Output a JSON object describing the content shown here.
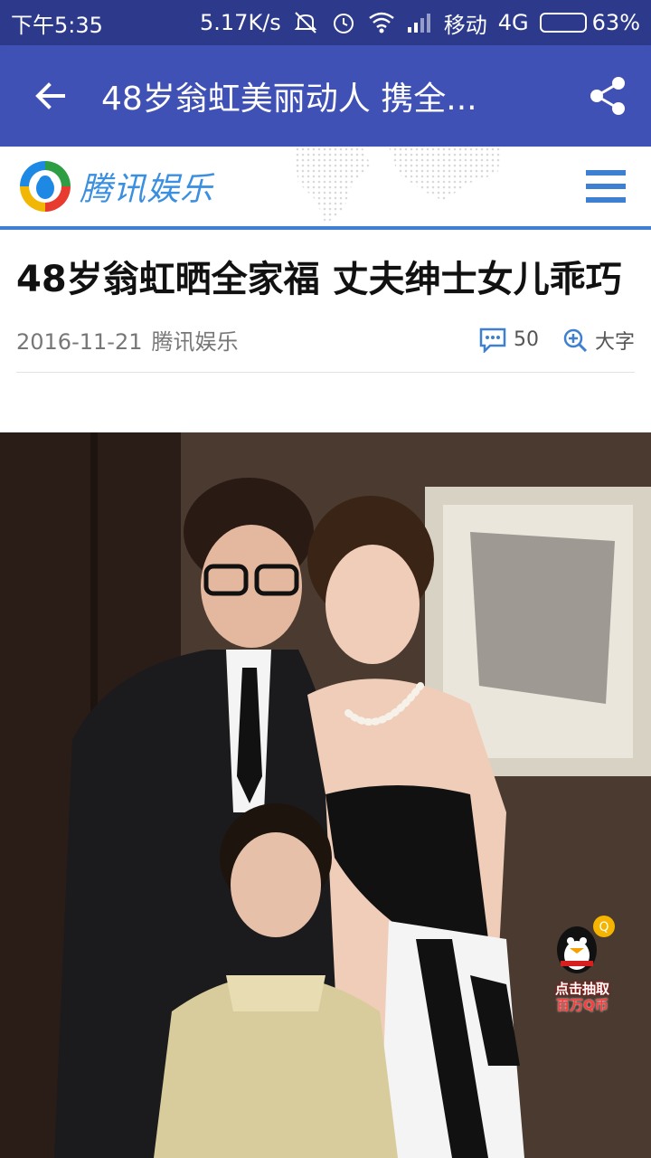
{
  "status_bar": {
    "time": "下午5:35",
    "speed": "5.17K/s",
    "carrier": "移动",
    "network": "4G",
    "battery": "63%",
    "battery_level": 0.63,
    "icons": [
      "mute-icon",
      "alarm-icon",
      "wifi-icon",
      "signal-icon",
      "battery-icon"
    ]
  },
  "app_bar": {
    "title": "48岁翁虹美丽动人 携全...",
    "back_icon": "arrow-left-icon",
    "share_icon": "share-icon"
  },
  "site": {
    "brand_name": "腾讯娱乐",
    "menu_icon": "hamburger-menu-icon",
    "accent": "#3d7fd0"
  },
  "article": {
    "headline": "48岁翁虹晒全家福 丈夫绅士女儿乖巧",
    "date": "2016-11-21",
    "source": "腾讯娱乐",
    "comment_count": "50",
    "font_size_label": "大字"
  },
  "photo": {
    "badge_line1": "点击抽取",
    "badge_line2": "百万Q币"
  },
  "colors": {
    "status_bar": "#2d3a8c",
    "app_bar": "#3f51b5"
  }
}
